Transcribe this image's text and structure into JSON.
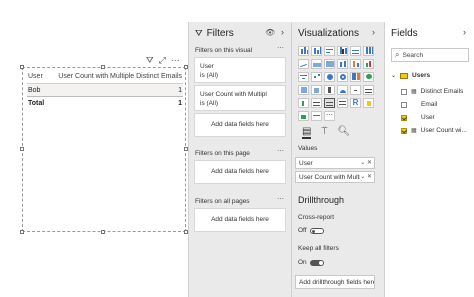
{
  "visual": {
    "headers": [
      "User",
      "User Count with Multiple Distinct Emails"
    ],
    "rows": [
      [
        "Bob",
        "1"
      ]
    ],
    "total": [
      "Total",
      "1"
    ]
  },
  "filters": {
    "title": "Filters",
    "on_visual_label": "Filters on this visual",
    "card1_field": "User",
    "card1_value": "is (All)",
    "card2_field": "User Count with Multipl",
    "card2_value": "is (All)",
    "add_data": "Add data fields here",
    "on_page_label": "Filters on this page",
    "on_all_pages_label": "Filters on all pages"
  },
  "viz": {
    "title": "Visualizations",
    "values_label": "Values",
    "well1": "User",
    "well2": "User Count with Multipl",
    "drillthrough_title": "Drillthrough",
    "cross_report_label": "Cross-report",
    "cross_report_state": "Off",
    "keep_filters_label": "Keep all filters",
    "keep_filters_state": "On",
    "add_drill": "Add drillthrough fields here"
  },
  "fields": {
    "title": "Fields",
    "search_placeholder": "Search",
    "table_name": "Users",
    "items": [
      {
        "label": "Distinct Emails",
        "checked": false
      },
      {
        "label": "Email",
        "checked": false
      },
      {
        "label": "User",
        "checked": true
      },
      {
        "label": "User Count wi...",
        "checked": true
      }
    ]
  },
  "colors": {
    "accent": "#f2c811",
    "pane_bg": "#eaeaea",
    "viz_blue": "#3a78c8"
  }
}
